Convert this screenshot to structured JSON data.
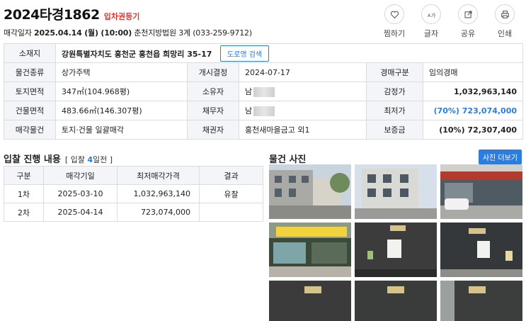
{
  "header": {
    "case_number": "2024타경1862",
    "badge": "입차권등기",
    "meta_prefix": "매각일자",
    "sale_datetime": "2025.04.14 (월) (10:00)",
    "court": "춘천지방법원 3계 (033-259-9712)"
  },
  "actions": [
    {
      "label": "찜하기",
      "icon": "heart-icon"
    },
    {
      "label": "글자",
      "icon": "font-size-icon"
    },
    {
      "label": "공유",
      "icon": "share-icon"
    },
    {
      "label": "인쇄",
      "icon": "print-icon"
    }
  ],
  "info": {
    "address_label": "소재지",
    "address": "강원특별자치도 홍천군 홍천읍 희망리 35-17",
    "road_button": "도로명 검색",
    "rows": [
      {
        "l1": "물건종류",
        "v1": "상가주택",
        "l2": "개시결정",
        "v2": "2024-07-17",
        "l3": "경매구분",
        "v3": "임의경매"
      },
      {
        "l1": "토지면적",
        "v1": "347㎡(104.968평)",
        "l2": "소유자",
        "v2": "남",
        "l3": "감정가",
        "v3": "1,032,963,140"
      },
      {
        "l1": "건물면적",
        "v1": "483.66㎡(146.307평)",
        "l2": "채무자",
        "v2": "남",
        "l3": "최저가",
        "v3": "(70%) 723,074,000"
      },
      {
        "l1": "매각물건",
        "v1": "토지·건물 일괄매각",
        "l2": "채권자",
        "v2": "홍천새마을금고 외1",
        "l3": "보증금",
        "v3": "(10%) 72,307,400"
      }
    ]
  },
  "bid": {
    "title": "입찰 진행 내용",
    "sub_pre": "[ 입찰",
    "sub_count": "4",
    "sub_post": "일전 ]",
    "headers": [
      "구분",
      "매각기일",
      "최저매각가격",
      "결과"
    ],
    "rows": [
      {
        "round": "1차",
        "date": "2025-03-10",
        "price": "1,032,963,140",
        "result": "유찰"
      },
      {
        "round": "2차",
        "date": "2025-04-14",
        "price": "723,074,000",
        "result": ""
      }
    ]
  },
  "photos": {
    "title": "물건 사진",
    "more_button": "사진 더보기",
    "count": 9
  },
  "colors": {
    "accent": "#2a7de1",
    "badge": "#e5322d",
    "header_bg": "#f3f5f8"
  }
}
